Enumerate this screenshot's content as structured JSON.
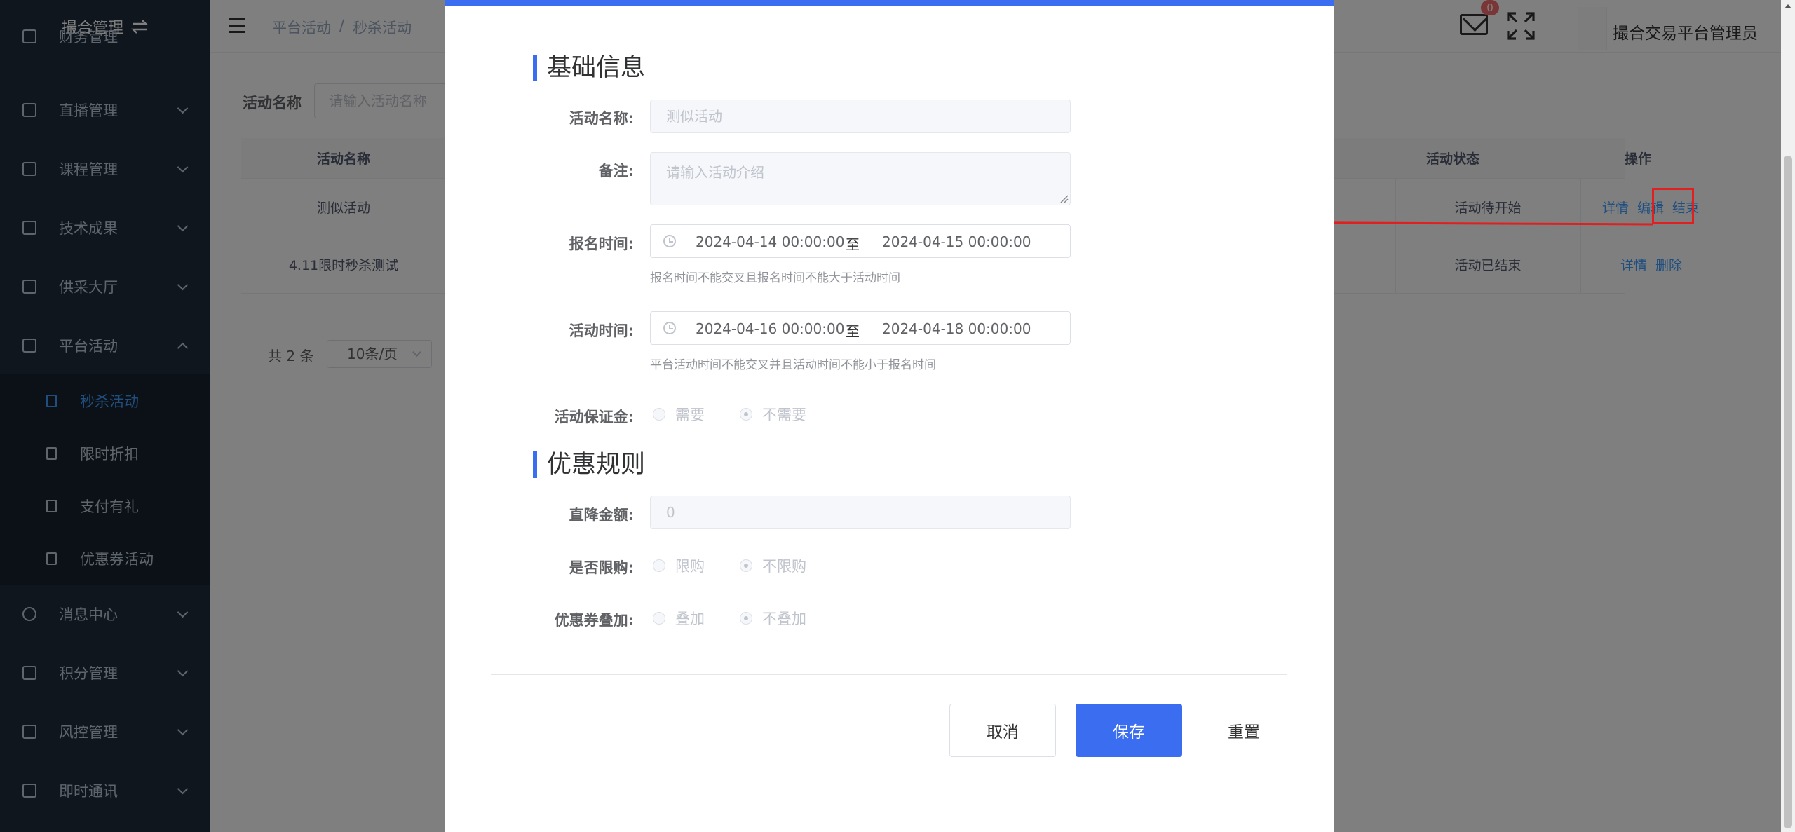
{
  "sidebar": {
    "title": "撮合管理",
    "partial_item": "财务管理",
    "items": [
      {
        "label": "直播管理"
      },
      {
        "label": "课程管理"
      },
      {
        "label": "技术成果"
      },
      {
        "label": "供采大厅"
      },
      {
        "label": "平台活动"
      }
    ],
    "subitems": [
      {
        "label": "秒杀活动"
      },
      {
        "label": "限时折扣"
      },
      {
        "label": "支付有礼"
      },
      {
        "label": "优惠券活动"
      }
    ],
    "items_after": [
      {
        "label": "消息中心"
      },
      {
        "label": "积分管理"
      },
      {
        "label": "风控管理"
      },
      {
        "label": "即时通讯"
      }
    ]
  },
  "header": {
    "breadcrumb": [
      "平台活动",
      "/",
      "秒杀活动"
    ],
    "mail_badge": "0",
    "username": "撮合交易平台管理员"
  },
  "page": {
    "filter_label": "活动名称",
    "filter_placeholder": "请输入活动名称",
    "table": {
      "headers": {
        "name": "活动名称",
        "status": "活动状态",
        "ops": "操作"
      },
      "rows": [
        {
          "name": "测似活动",
          "status": "活动待开始",
          "op1": "详情",
          "op2": "编辑",
          "op3": "结束"
        },
        {
          "name": "4.11限时秒杀测试",
          "status": "活动已结束",
          "op1": "详情",
          "op2": "删除"
        }
      ]
    },
    "pager": {
      "total": "共 2 条",
      "page_size": "10条/页"
    }
  },
  "dialog": {
    "section_basic": "基础信息",
    "name_label": "活动名称:",
    "name_value": "测似活动",
    "remark_label": "备注:",
    "remark_placeholder": "请输入活动介绍",
    "signup_label": "报名时间:",
    "signup_start": "2024-04-14 00:00:00",
    "signup_sep": "至",
    "signup_end": "2024-04-15 00:00:00",
    "signup_hint": "报名时间不能交叉且报名时间不能大于活动时间",
    "activity_label": "活动时间:",
    "activity_start": "2024-04-16 00:00:00",
    "activity_sep": "至",
    "activity_end": "2024-04-18 00:00:00",
    "activity_hint": "平台活动时间不能交叉并且活动时间不能小于报名时间",
    "deposit_label": "活动保证金:",
    "deposit_options": [
      "需要",
      "不需要"
    ],
    "deposit_selected": "不需要",
    "section_rules": "优惠规则",
    "discount_label": "直降金额:",
    "discount_value": "0",
    "limit_label": "是否限购:",
    "limit_options": [
      "限购",
      "不限购"
    ],
    "limit_selected": "不限购",
    "coupon_label": "优惠券叠加:",
    "coupon_options": [
      "叠加",
      "不叠加"
    ],
    "coupon_selected": "不叠加",
    "cancel_label": "取消",
    "save_label": "保存",
    "reset_label": "重置"
  },
  "colors": {
    "sidebar_bg": "#1f2d3d",
    "submenu_bg": "#18222f",
    "accent": "#3a6df0",
    "link": "#409eff",
    "annotation": "#e02020"
  },
  "icons": [
    "switch-icon",
    "menu-toggle-icon",
    "mail-icon",
    "fullscreen-icon",
    "clock-icon",
    "chevron-down-icon",
    "chevron-up-icon"
  ]
}
